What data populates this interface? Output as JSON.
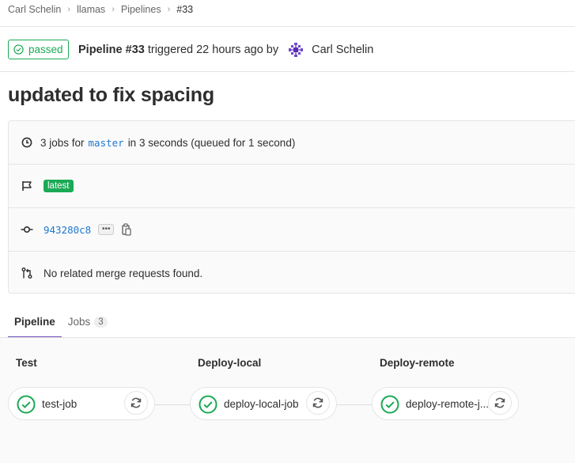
{
  "breadcrumb": [
    "Carl Schelin",
    "llamas",
    "Pipelines",
    "#33"
  ],
  "header": {
    "status": "passed",
    "pipeline_label": "Pipeline #33",
    "triggered_text": " triggered 22 hours ago by ",
    "author": "Carl Schelin"
  },
  "title": "updated to fix spacing",
  "info": {
    "jobs_prefix": "3 jobs for",
    "branch": "master",
    "jobs_suffix": "in 3 seconds (queued for 1 second)",
    "tag": "latest",
    "commit_sha": "943280c8",
    "ellipsis": "•••",
    "merge_requests": "No related merge requests found."
  },
  "tabs": [
    {
      "label": "Pipeline",
      "active": true
    },
    {
      "label": "Jobs",
      "count": "3",
      "active": false
    }
  ],
  "stages": [
    {
      "name": "Test",
      "job": "test-job"
    },
    {
      "name": "Deploy-local",
      "job": "deploy-local-job"
    },
    {
      "name": "Deploy-remote",
      "job": "deploy-remote-j..."
    }
  ],
  "colors": {
    "success": "#1aaa55",
    "link": "#1f78d1",
    "tab_active": "#6b4fbb"
  },
  "icons": {
    "status": "check-circle-icon",
    "avatar": "identicon",
    "jobs": "clock-icon",
    "tag": "flag-icon",
    "commit": "commit-icon",
    "copy": "clipboard-icon",
    "merge": "merge-request-icon",
    "job_status": "check-circle-icon",
    "retry": "retry-icon"
  }
}
